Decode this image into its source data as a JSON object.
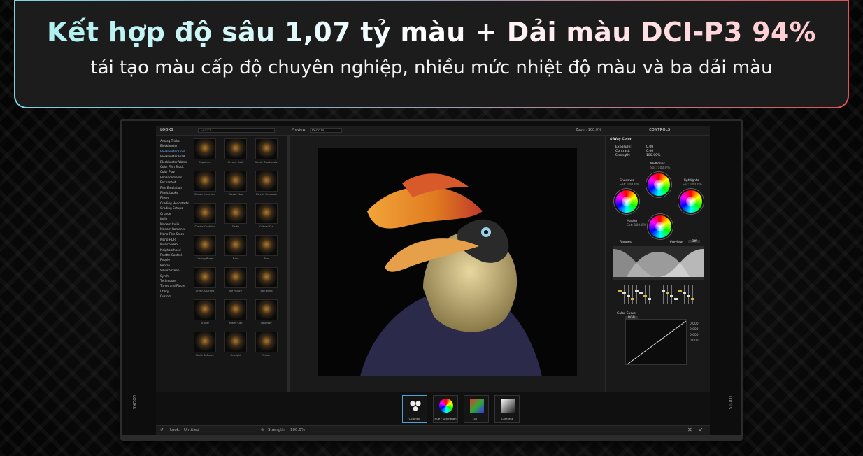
{
  "banner": {
    "headline": "Kết hợp độ sâu 1,07 tỷ màu + Dải màu DCI-P3 94%",
    "subline": "tái tạo màu cấp độ chuyên nghiệp, nhiều mức nhiệt độ màu và ba dải màu"
  },
  "app": {
    "looks_title": "LOOKS",
    "search_placeholder": "Search",
    "preview_label": "Preview:",
    "preview_value": "Rec709",
    "zoom": "Zoom: 100.0%",
    "controls_title": "CONTROLS",
    "left_edge_label": "LOOKS",
    "right_edge_label": "TOOLS",
    "categories": [
      "Analog Tricks",
      "Blockbuster",
      "Blockbuster Cool",
      "Blockbuster HDR",
      "Blockbuster Warm",
      "Color Film Stock",
      "Color Play",
      "Enhancements",
      "Enchanted",
      "Film Emulation",
      "Filmic Looks",
      "Filters",
      "Grading Headstarts",
      "Grading Setups",
      "Grunge",
      "Indie",
      "Modern Indie",
      "Modern Romance",
      "Mono Film Stock",
      "Mono HDR",
      "Music Video",
      "Neighborhood",
      "Palette Control",
      "People",
      "Replay",
      "Silver Screen",
      "Synth",
      "Techniques",
      "Times and Places",
      "Utility",
      "Custom"
    ],
    "thumbs": [
      "Capsicum",
      "Chrono Rush",
      "Classic Blockbuster",
      "Classic Inversion",
      "Classic Neo",
      "Classic Unreason",
      "Classic Confetto",
      "Delfin",
      "Critical Cut",
      "Cutting Board",
      "Fried",
      "Fun",
      "Green Sparrow",
      "Ice Palace",
      "Iron Wing",
      "Kruger",
      "Miami Cab",
      "Neo Noir",
      "North & Space",
      "Onelight",
      "Pelham"
    ],
    "controls": {
      "section": "4-Way Color",
      "exposure_label": "Exposure:",
      "exposure_value": "0.00",
      "contrast_label": "Contrast:",
      "contrast_value": "0.00",
      "strength_label": "Strength:",
      "strength_value": "100.00%",
      "midtones": "Midtones",
      "midtones_sat": "Sat: 100.0%",
      "shadows": "Shadows",
      "shadows_sat": "Sat: 100.0%",
      "highlights": "Highlights",
      "highlights_sat": "Sat: 100.0%",
      "master": "Master",
      "master_sat": "Sat: 100.0%",
      "ranges": "Ranges",
      "preview": "Preview:",
      "preview_toggle": "Off",
      "color_curve": "Color Curve",
      "rgb": "RGB",
      "curve_values": [
        "0.000",
        "0.000",
        "0.000",
        "0.000"
      ]
    },
    "tools": [
      {
        "label": "Colorista",
        "icon": "colorista-icon"
      },
      {
        "label": "Hue / Saturation",
        "icon": "hue-saturation-icon"
      },
      {
        "label": "LUT",
        "icon": "lut-icon"
      },
      {
        "label": "Contrast",
        "icon": "contrast-icon"
      }
    ],
    "status": {
      "look_label": "Look:",
      "look_value": "Untitled",
      "strength_label": "Strength:",
      "strength_value": "100.0%"
    }
  },
  "colors": {
    "banner_border_left": "#7fd3df",
    "banner_border_right": "#e0545a",
    "accent_blue": "#4aa3d8"
  }
}
